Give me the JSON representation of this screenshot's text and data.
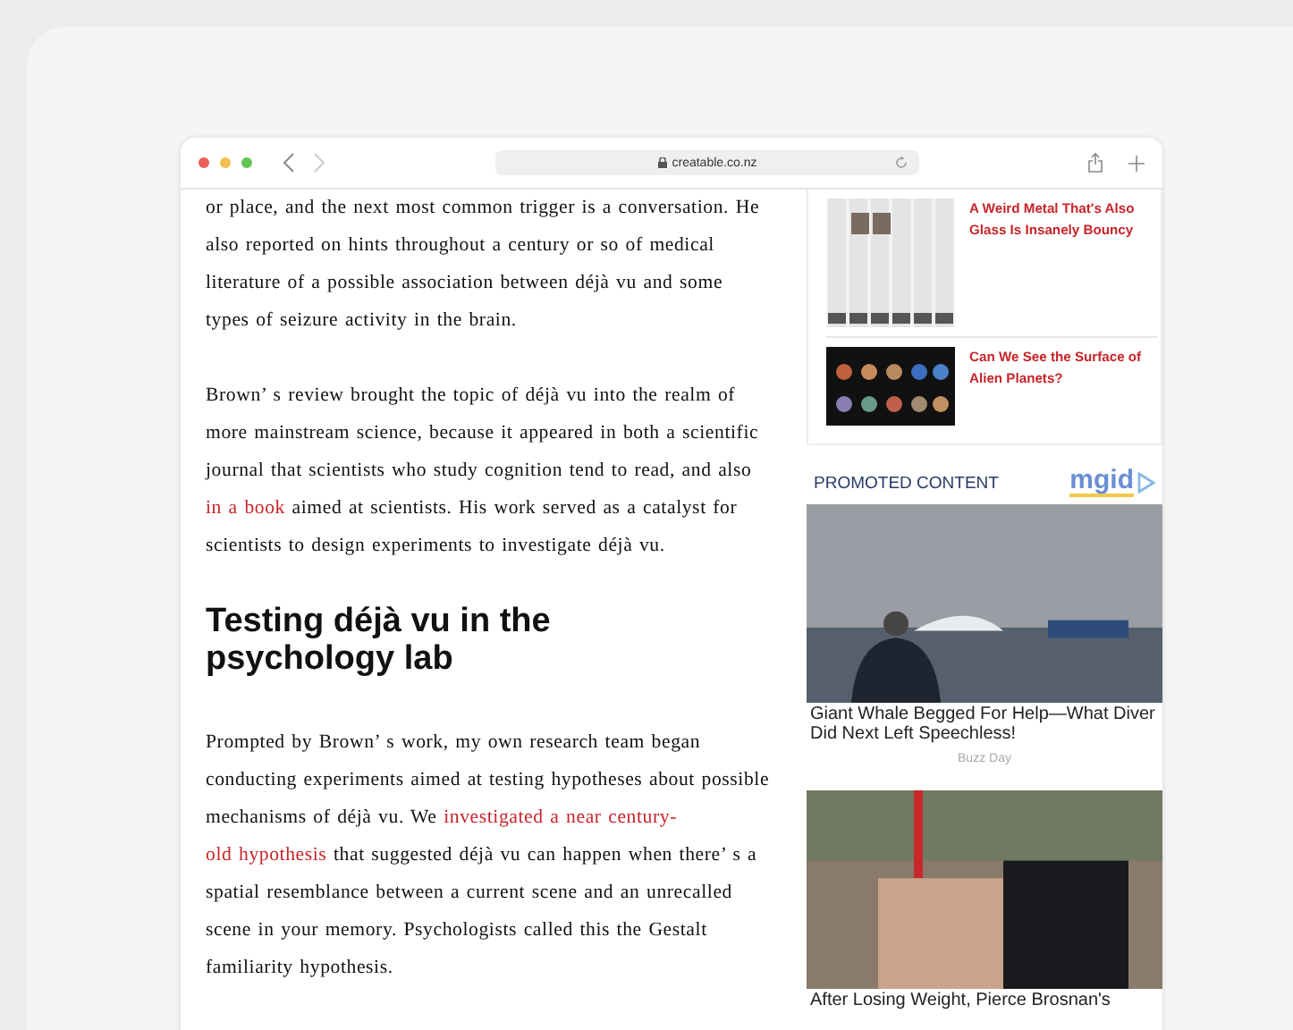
{
  "browser": {
    "address": "creatable.co.nz"
  },
  "article": {
    "blocks": [
      {
        "kind": "paragraph",
        "segments": [
          {
            "kind": "text",
            "text": "or place, and the next most common trigger is a conversation. He also reported on hints throughout a century or so of medical literature of a possible association between déjà vu and some types of seizure activity in the brain."
          }
        ]
      },
      {
        "kind": "paragraph",
        "segments": [
          {
            "kind": "text",
            "text": "Brown’ s review brought the topic of déjà vu into the realm of more mainstream science, because it appeared in both a scientific journal that scientists who study cognition tend to read, and also "
          },
          {
            "kind": "link",
            "text": "in a book"
          },
          {
            "kind": "text",
            "text": " aimed at scientists. His work served as a catalyst for scientists to design experiments to investigate déjà vu."
          }
        ]
      },
      {
        "kind": "heading",
        "text": "Testing déjà vu in the psychology lab"
      },
      {
        "kind": "paragraph",
        "segments": [
          {
            "kind": "text",
            "text": "Prompted by Brown’ s work, my own research team began conducting experiments aimed at testing hypotheses about possible mechanisms of déjà vu. We "
          },
          {
            "kind": "link",
            "text": "investigated a near century-"
          },
          {
            "kind": "link",
            "text": "old hypothesis"
          },
          {
            "kind": "text",
            "text": " that suggested déjà vu can happen when there’ s a spatial resemblance between a current scene and an unrecalled scene in your memory. Psychologists called this the Gestalt familiarity hypothesis."
          }
        ]
      }
    ]
  },
  "related": [
    {
      "kind": "metal",
      "title": "A Weird Metal That's Also Glass Is Insanely Bouncy"
    },
    {
      "kind": "planets",
      "title": "Can We See the Surface of Alien Planets?"
    }
  ],
  "promoted": {
    "label": "PROMOTED CONTENT",
    "brand": "mgid",
    "items": [
      {
        "kind": "sea",
        "title": "Giant Whale Begged For Help—What Diver Did Next Left Speechless!",
        "source": "Buzz Day"
      },
      {
        "kind": "crowd",
        "title": "After Losing Weight, Pierce Brosnan's"
      }
    ]
  }
}
